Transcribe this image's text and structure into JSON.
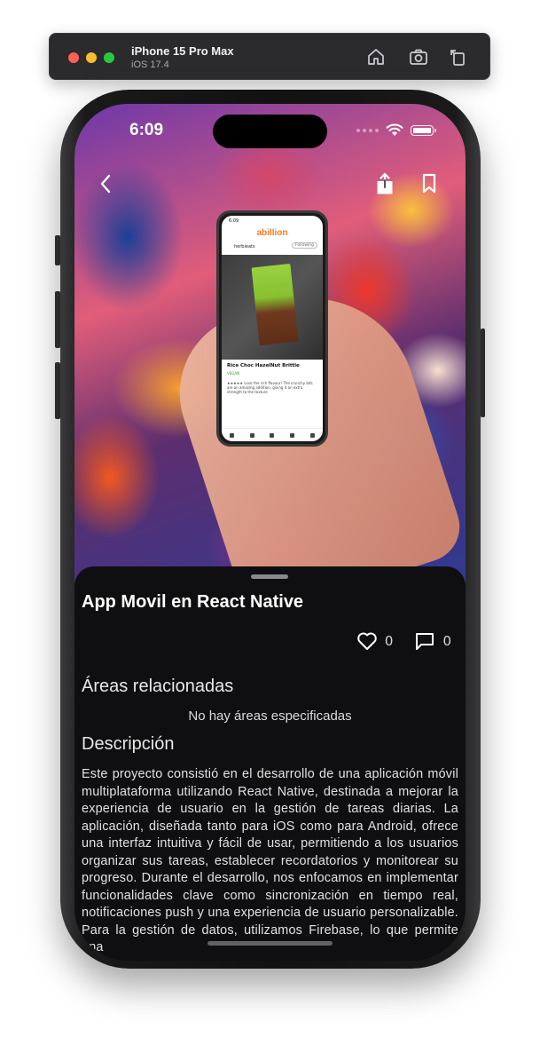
{
  "simulator": {
    "device_name": "iPhone 15 Pro Max",
    "os_version": "iOS 17.4",
    "icons": [
      "home-icon",
      "screenshot-icon",
      "rotate-icon"
    ]
  },
  "status_bar": {
    "time": "6:09"
  },
  "hero": {
    "mini_app": {
      "status_time": "6:09",
      "logo_prefix": "abil",
      "logo_accent": "li",
      "logo_suffix": "on",
      "username": "herbieats",
      "follow_label": "Following",
      "product_name": "Rice Choc HazelNut Brittle",
      "product_tag": "VEGAN",
      "review_text": "★★★★★ Love the rich flavour! The crunchy bits are an amazing addition, giving it an extra strength to the texture"
    }
  },
  "project": {
    "title": "App Movil en React Native",
    "likes": "0",
    "comments": "0",
    "areas_heading": "Áreas relacionadas",
    "areas_empty": "No hay áreas especificadas",
    "description_heading": "Descripción",
    "description": "Este proyecto consistió en el desarrollo de una aplicación móvil multiplataforma utilizando React Native, destinada a mejorar la experiencia de usuario en la gestión de tareas diarias. La aplicación, diseñada tanto para iOS como para Android, ofrece una interfaz intuitiva y fácil de usar, permitiendo a los usuarios organizar sus tareas, establecer recordatorios y monitorear su progreso. Durante el desarrollo, nos enfocamos en implementar funcionalidades clave como sincronización en tiempo real, notificaciones push y una experiencia de usuario personalizable. Para la gestión de datos, utilizamos Firebase, lo que permite una"
  },
  "colors": {
    "sheet_background": "#0f0f11",
    "text_primary": "#ffffff",
    "text_secondary": "#e2e2e2"
  }
}
